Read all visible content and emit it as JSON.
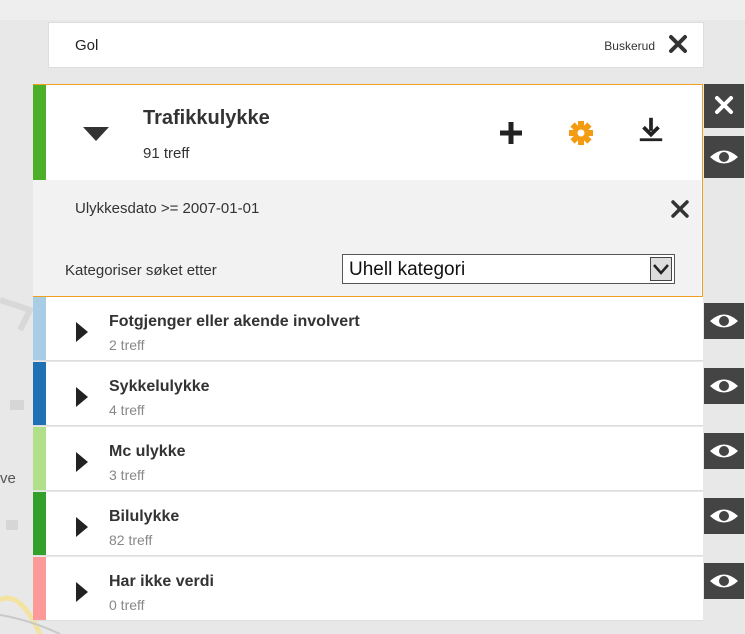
{
  "search": {
    "place": "Gol",
    "region": "Buskerud"
  },
  "map": {
    "partial_label": "ve"
  },
  "layer": {
    "title": "Trafikkulykke",
    "count": "91 treff",
    "accent_color": "#4caf28",
    "border_color": "#f0a020",
    "filter_text": "Ulykkesdato >= 2007-01-01",
    "categorize_label": "Kategoriser søket etter",
    "categorize_value": "Uhell kategori",
    "buttons": [
      "plus-icon",
      "gear-icon",
      "download-icon"
    ]
  },
  "categories": [
    {
      "name": "Fotgjenger eller akende involvert",
      "count": "2 treff",
      "color": "#a8cde4"
    },
    {
      "name": "Sykkelulykke",
      "count": "4 treff",
      "color": "#2071b4"
    },
    {
      "name": "Mc ulykke",
      "count": "3 treff",
      "color": "#b2df8a"
    },
    {
      "name": "Bilulykke",
      "count": "82 treff",
      "color": "#33a02c"
    },
    {
      "name": "Har ikke verdi",
      "count": "0 treff",
      "color": "#fb9a99"
    }
  ]
}
